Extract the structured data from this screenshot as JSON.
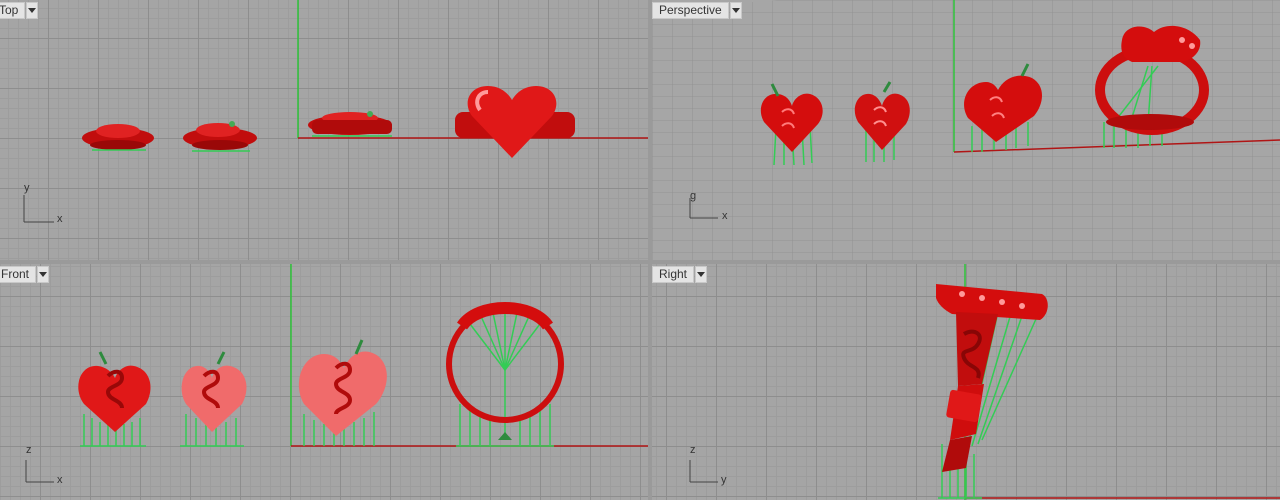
{
  "viewports": {
    "top": {
      "label": "Top",
      "axes": {
        "vertical": "y",
        "horizontal": "x"
      }
    },
    "perspective": {
      "label": "Perspective",
      "axes": {
        "vertical": "g",
        "horizontal": "x"
      }
    },
    "front": {
      "label": "Front",
      "axes": {
        "vertical": "z",
        "horizontal": "x"
      }
    },
    "right": {
      "label": "Right",
      "axes": {
        "vertical": "z",
        "horizontal": "y"
      }
    }
  },
  "colors": {
    "model": "#d40d0d",
    "model_light": "#f06b6b",
    "supports": "#33cc55",
    "x_axis": "#b01515",
    "y_axis": "#2ec43a",
    "grid": "#8e8e8e",
    "background": "#a5a5a5"
  },
  "icons": {
    "viewport_menu": "chevron-down-icon"
  }
}
